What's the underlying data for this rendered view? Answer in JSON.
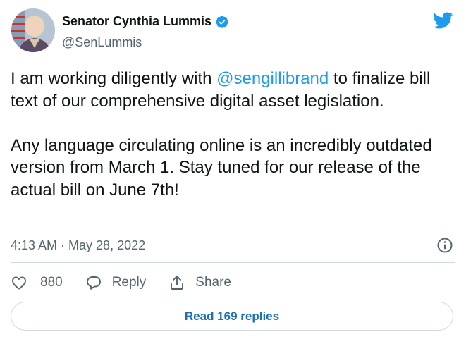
{
  "author": {
    "display_name": "Senator Cynthia Lummis",
    "handle": "@SenLummis"
  },
  "icons": {
    "verified": "verified-badge-icon",
    "brand": "twitter-bird-icon",
    "info": "info-icon",
    "like": "heart-icon",
    "reply": "speech-bubble-icon",
    "share": "share-upload-icon"
  },
  "tweet": {
    "paragraph1": {
      "before": "I am working diligently with ",
      "mention": "@sengillibrand",
      "after": " to finalize bill text of our comprehensive digital asset legislation."
    },
    "paragraph2": "Any language circulating online is an incredibly outdated version from March 1. Stay tuned for our release of the actual bill on June 7th!",
    "timestamp": "4:13 AM · May 28, 2022"
  },
  "actions": {
    "like_count": "880",
    "reply_label": "Reply",
    "share_label": "Share"
  },
  "read_replies_label": "Read 169 replies",
  "colors": {
    "brand_blue": "#1d9bf0",
    "text": "#0f1419",
    "secondary_text": "#536471",
    "divider": "#cfd9de",
    "button_text": "#1d6fb8"
  }
}
